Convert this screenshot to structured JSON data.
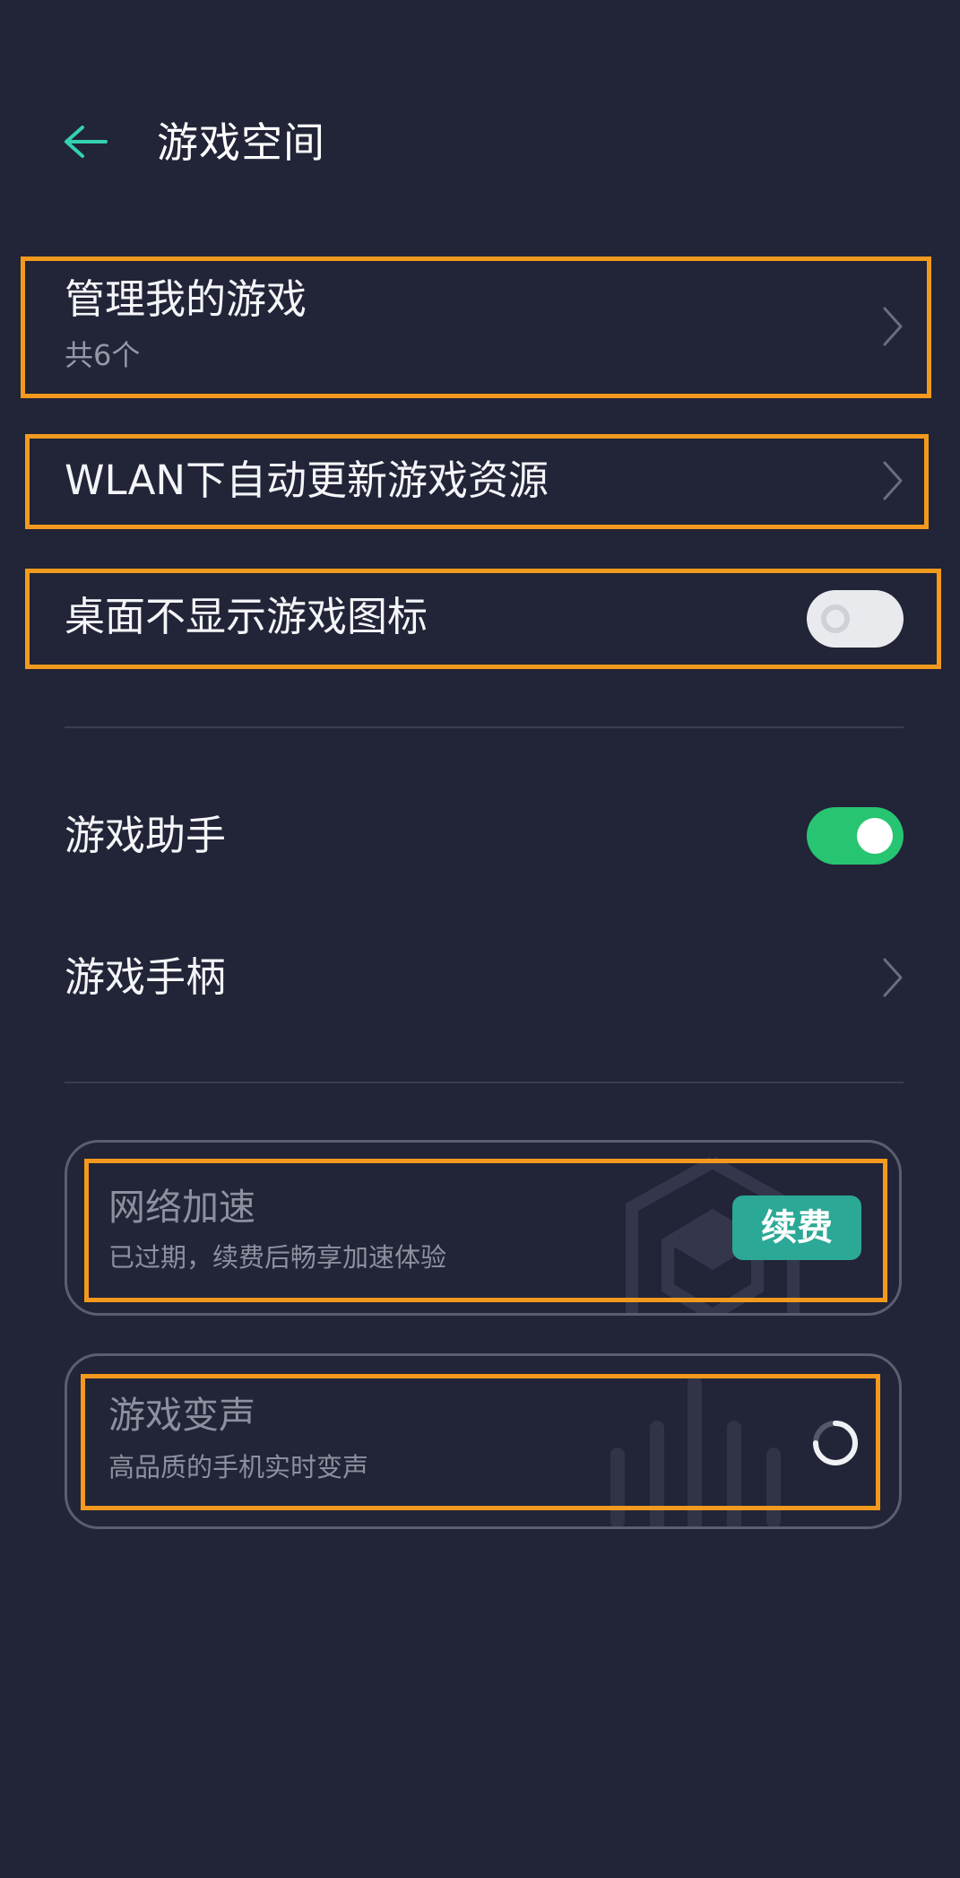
{
  "header": {
    "title": "游戏空间",
    "back_icon": "arrow-left-icon",
    "accent_color": "#33d1b0"
  },
  "settings": {
    "manage_games": {
      "label": "管理我的游戏",
      "sublabel": "共6个"
    },
    "wlan_update": {
      "label": "WLAN下自动更新游戏资源"
    },
    "hide_icon": {
      "label": "桌面不显示游戏图标",
      "enabled": false
    },
    "game_assistant": {
      "label": "游戏助手",
      "enabled": true
    },
    "gamepad": {
      "label": "游戏手柄"
    }
  },
  "cards": {
    "network_boost": {
      "title": "网络加速",
      "subtitle": "已过期，续费后畅享加速体验",
      "button_label": "续费",
      "bg_icon": "cube-network-icon"
    },
    "voice_changer": {
      "title": "游戏变声",
      "subtitle": "高品质的手机实时变声",
      "status_icon": "loading-spinner-icon",
      "bg_icon": "sound-wave-icon"
    }
  },
  "colors": {
    "background": "#222437",
    "toggle_on": "#27c572",
    "renew_button": "#2ba896",
    "highlight": "#f39a1e"
  }
}
